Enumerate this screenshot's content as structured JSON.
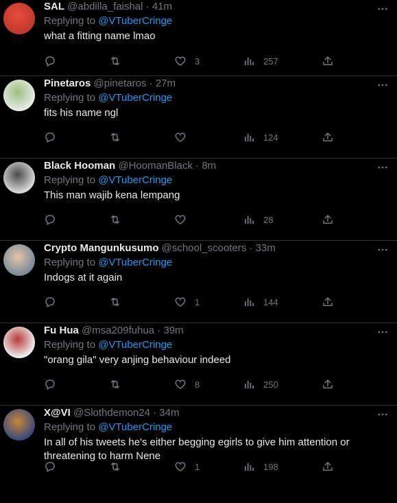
{
  "tweets": [
    {
      "name": "SAL",
      "handle": "@abdilla_faishal",
      "time": "41m",
      "replying_label": "Replying to",
      "replying_to": "@VTuberCringe",
      "text": "what a fitting name lmao",
      "likes": "3",
      "views": "257",
      "avatar_colors": [
        "#c0392b",
        "#e74c3c"
      ]
    },
    {
      "name": "Pinetaros",
      "handle": "@pinetaros",
      "time": "27m",
      "replying_label": "Replying to",
      "replying_to": "@VTuberCringe",
      "text": "fits his name ngl",
      "likes": "",
      "views": "124",
      "avatar_colors": [
        "#e8ebe6",
        "#9bbf7f"
      ]
    },
    {
      "name": "Black Hooman",
      "handle": "@HoomanBlack",
      "time": "8m",
      "replying_label": "Replying to",
      "replying_to": "@VTuberCringe",
      "text": "This man wajib kena lempang",
      "likes": "",
      "views": "28",
      "avatar_colors": [
        "#d9d9d9",
        "#4a4a4a"
      ]
    },
    {
      "name": "Crypto Mangunkusumo",
      "handle": "@school_scooters",
      "time": "33m",
      "replying_label": "Replying to",
      "replying_to": "@VTuberCringe",
      "text": "Indogs at it again",
      "likes": "1",
      "views": "144",
      "avatar_colors": [
        "#7b8a9a",
        "#e3c6a8"
      ]
    },
    {
      "name": "Fu Hua",
      "handle": "@msa209fuhua",
      "time": "39m",
      "replying_label": "Replying to",
      "replying_to": "@VTuberCringe",
      "text": "\"orang gila\" very anjing behaviour indeed",
      "likes": "8",
      "views": "250",
      "avatar_colors": [
        "#eeeeee",
        "#b83a3a"
      ]
    },
    {
      "name": "X@VI",
      "handle": "@Slothdemon24",
      "time": "34m",
      "replying_label": "Replying to",
      "replying_to": "@VTuberCringe",
      "text": "In all of his tweets he's either begging egirls to give him attention or threatening to harm Nene",
      "likes": "1",
      "views": "198",
      "avatar_colors": [
        "#3a4a7a",
        "#c9863a"
      ]
    }
  ],
  "icons": {
    "reply": "reply-icon",
    "retweet": "retweet-icon",
    "like": "like-icon",
    "views": "views-icon",
    "share": "share-icon",
    "more": "more-icon"
  }
}
